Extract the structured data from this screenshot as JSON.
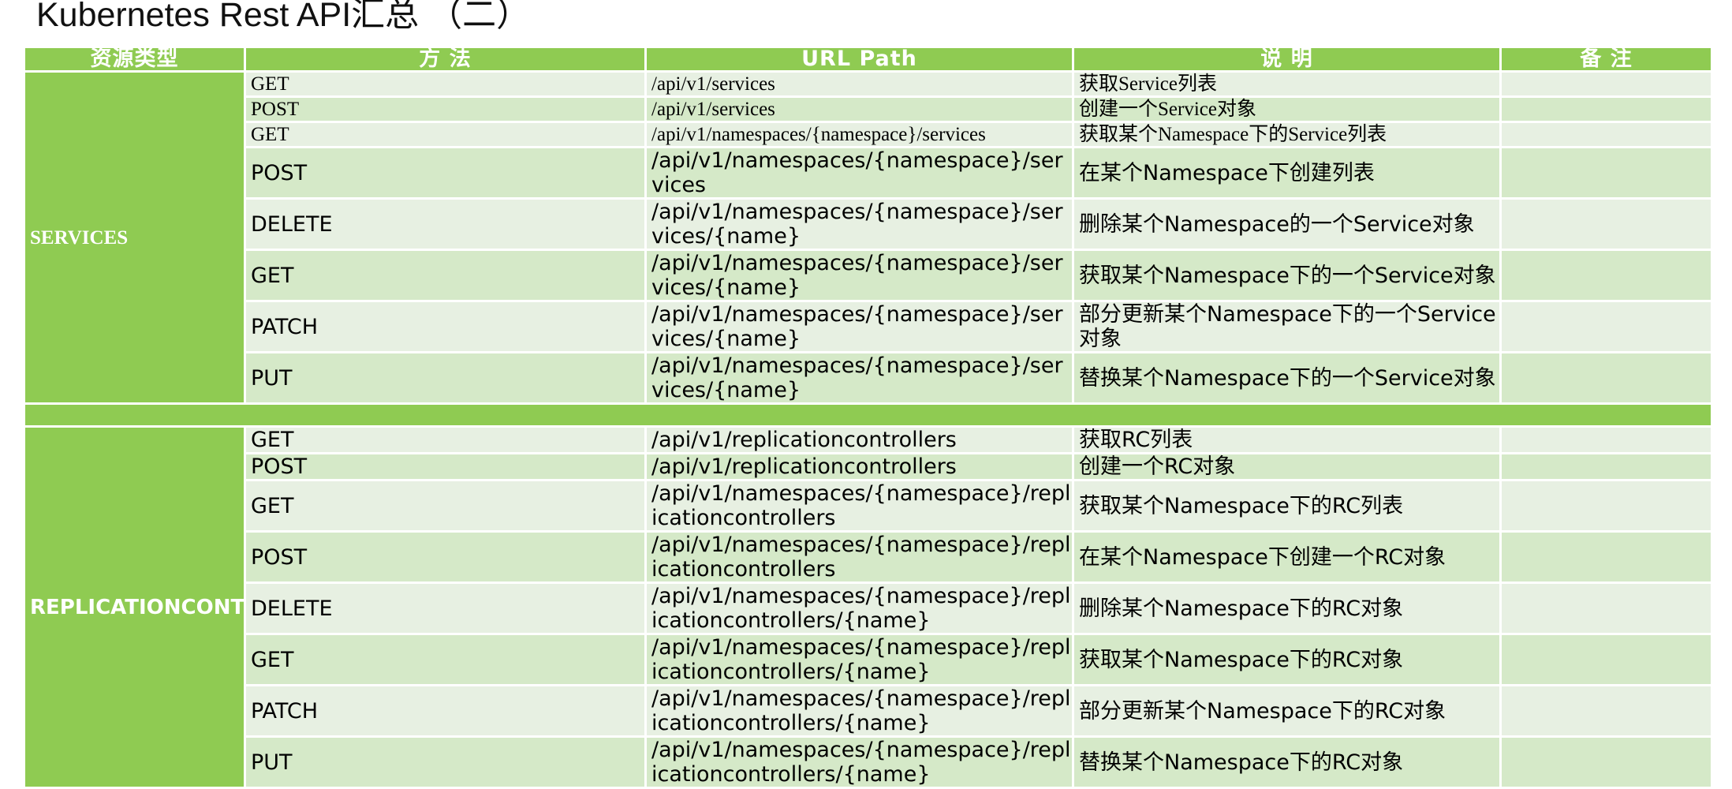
{
  "title": "Kubernetes Rest API汇总 （二）",
  "headers": [
    "资源类型",
    "方    法",
    "URL Path",
    "说    明",
    "备    注"
  ],
  "groups": [
    {
      "type": "SERVICES",
      "rows": [
        {
          "method": "GET",
          "path": "/api/v1/services",
          "desc": "获取Service列表",
          "note": ""
        },
        {
          "method": "POST",
          "path": "/api/v1/services",
          "desc": "创建一个Service对象",
          "note": ""
        },
        {
          "method": "GET",
          "path": "/api/v1/namespaces/{namespace}/services",
          "desc": "获取某个Namespace下的Service列表",
          "note": ""
        },
        {
          "method": "POST",
          "path": "/api/v1/namespaces/{namespace}/services",
          "desc": "在某个Namespace下创建列表",
          "note": ""
        },
        {
          "method": "DELETE",
          "path": "/api/v1/namespaces/{namespace}/services/{name}",
          "desc": "删除某个Namespace的一个Service对象",
          "note": ""
        },
        {
          "method": "GET",
          "path": "/api/v1/namespaces/{namespace}/services/{name}",
          "desc": "获取某个Namespace下的一个Service对象",
          "note": ""
        },
        {
          "method": "PATCH",
          "path": "/api/v1/namespaces/{namespace}/services/{name}",
          "desc": "部分更新某个Namespace下的一个Service对象",
          "note": ""
        },
        {
          "method": "PUT",
          "path": "/api/v1/namespaces/{namespace}/services/{name}",
          "desc": "替换某个Namespace下的一个Service对象",
          "note": ""
        }
      ]
    },
    {
      "type": "REPLICATIONCONTROLLERS",
      "rows": [
        {
          "method": "GET",
          "path": "/api/v1/replicationcontrollers",
          "desc": "获取RC列表",
          "note": ""
        },
        {
          "method": "POST",
          "path": "/api/v1/replicationcontrollers",
          "desc": "创建一个RC对象",
          "note": ""
        },
        {
          "method": "GET",
          "path": "/api/v1/namespaces/{namespace}/replicationcontrollers",
          "desc": "获取某个Namespace下的RC列表",
          "note": ""
        },
        {
          "method": "POST",
          "path": "/api/v1/namespaces/{namespace}/replicationcontrollers",
          "desc": "在某个Namespace下创建一个RC对象",
          "note": ""
        },
        {
          "method": "DELETE",
          "path": "/api/v1/namespaces/{namespace}/replicationcontrollers/{name}",
          "desc": "删除某个Namespace下的RC对象",
          "note": ""
        },
        {
          "method": "GET",
          "path": "/api/v1/namespaces/{namespace}/replicationcontrollers/{name}",
          "desc": "获取某个Namespace下的RC对象",
          "note": ""
        },
        {
          "method": "PATCH",
          "path": "/api/v1/namespaces/{namespace}/replicationcontrollers/{name}",
          "desc": "部分更新某个Namespace下的RC对象",
          "note": ""
        },
        {
          "method": "PUT",
          "path": "/api/v1/namespaces/{namespace}/replicationcontrollers/{name}",
          "desc": "替换某个Namespace下的RC对象",
          "note": ""
        }
      ]
    }
  ],
  "colors": {
    "header_green": "#8fcb52",
    "row_light": "#e7f0e2",
    "row_dark": "#d5e9c8",
    "text_white": "#ffffff"
  }
}
